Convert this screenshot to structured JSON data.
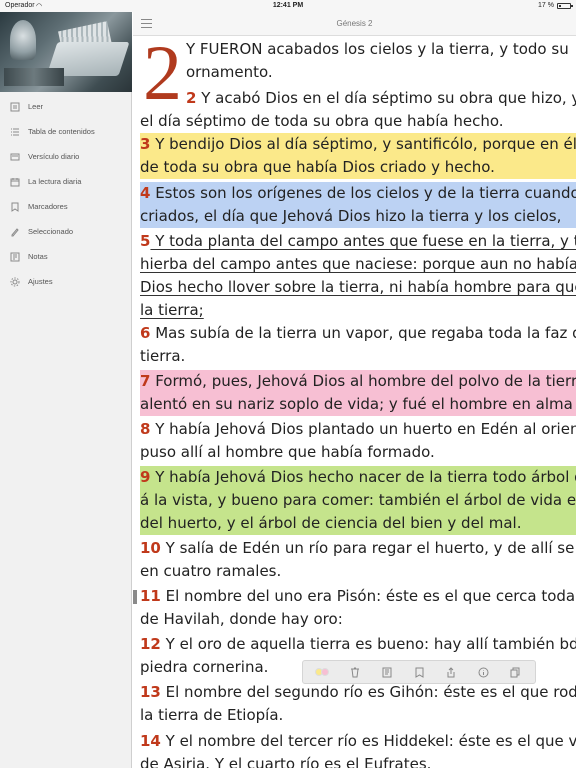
{
  "status": {
    "carrier": "Operador",
    "time": "12:41 PM",
    "battery": "17 %"
  },
  "header": {
    "title": "Génesis 2"
  },
  "sidebar": {
    "items": [
      {
        "label": "Leer",
        "icon": "read-icon"
      },
      {
        "label": "Tabla de contenidos",
        "icon": "list-icon"
      },
      {
        "label": "Versículo diario",
        "icon": "daily-verse-icon"
      },
      {
        "label": "La lectura diaria",
        "icon": "calendar-icon"
      },
      {
        "label": "Marcadores",
        "icon": "bookmark-icon"
      },
      {
        "label": "Seleccionado",
        "icon": "highlighter-icon"
      },
      {
        "label": "Notas",
        "icon": "notes-icon"
      },
      {
        "label": "Ajustes",
        "icon": "gear-icon"
      }
    ]
  },
  "reader": {
    "chapter": "2",
    "verses": [
      {
        "num": "",
        "lines": [
          "Y FUERON acabados los cielos y la tierra, y todo su",
          "ornamento."
        ]
      },
      {
        "num": "2",
        "lines": [
          " Y acabó Dios en el día séptimo su obra que hizo, y reposó",
          "el día séptimo de toda su obra que había hecho."
        ]
      },
      {
        "num": "3",
        "lines": [
          " Y bendijo Dios al día séptimo, y santificólo, porque en él reposó",
          "de toda su obra que había Dios criado y hecho."
        ]
      },
      {
        "num": "4",
        "lines": [
          " Estos son los orígenes de los cielos y de la tierra cuando fueron",
          "criados, el día que Jehová Dios hizo la tierra y los cielos,"
        ]
      },
      {
        "num": "5",
        "lines": [
          " Y toda planta del campo antes que fuese en la tierra, y toda",
          "hierba del campo antes que naciese: porque aun no había Jehová",
          "Dios hecho llover sobre la tierra, ni había hombre para que labrase",
          "la tierra;"
        ]
      },
      {
        "num": "6",
        "lines": [
          " Mas subía de la tierra un vapor, que regaba toda la faz de la",
          "tierra."
        ]
      },
      {
        "num": "7",
        "lines": [
          " Formó, pues, Jehová Dios al hombre del polvo de la tierra, y",
          "alentó en su nariz soplo de vida; y fué el hombre en alma viviente."
        ]
      },
      {
        "num": "8",
        "lines": [
          " Y había Jehová Dios plantado un huerto en Edén al oriente, y",
          "puso allí al hombre que había formado."
        ]
      },
      {
        "num": "9",
        "lines": [
          " Y había Jehová Dios hecho nacer de la tierra todo árbol delicioso",
          "á la vista, y bueno para comer: también el árbol de vida en medio",
          "del huerto, y el árbol de ciencia del bien y del mal."
        ]
      },
      {
        "num": "10",
        "lines": [
          " Y salía de Edén un río para regar el huerto, y de allí se repartía",
          "en cuatro ramales."
        ]
      },
      {
        "num": "11",
        "lines": [
          " El nombre del uno era Pisón: éste es el que cerca toda la tierra",
          "de Havilah, donde hay oro:"
        ]
      },
      {
        "num": "12",
        "lines": [
          " Y el oro de aquella tierra es bueno: hay allí también bdelio y",
          "piedra cornerina."
        ]
      },
      {
        "num": "13",
        "lines": [
          " El nombre del segundo río es Gihón: éste es el que rodea toda",
          "la tierra de Etiopía."
        ]
      },
      {
        "num": "14",
        "lines": [
          " Y el nombre del tercer río es Hiddekel: éste es el que va delante",
          "de Asiria. Y el cuarto río es el Eufrates."
        ]
      }
    ]
  },
  "toolbar": {
    "items": [
      "color-picker-icon",
      "trash-icon",
      "note-icon",
      "bookmark-icon",
      "share-icon",
      "info-icon",
      "copy-icon"
    ]
  },
  "colors": {
    "accent": "#c0391b",
    "highlight_yellow": "#fbe98a",
    "highlight_blue": "#bcd2f3",
    "highlight_pink": "#f7bfd3",
    "highlight_green": "#c5e48c"
  }
}
